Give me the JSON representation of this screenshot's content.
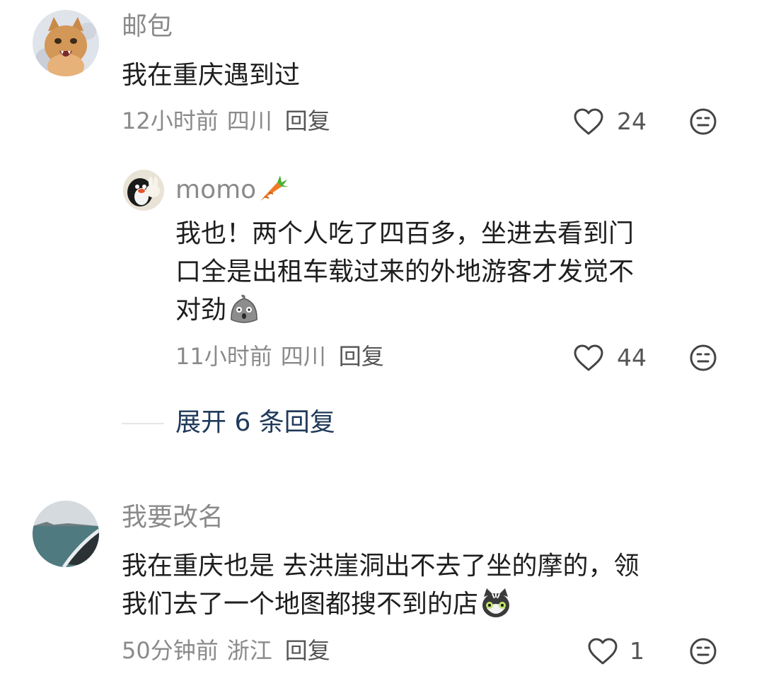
{
  "comments": [
    {
      "username": "邮包",
      "content": "我在重庆遇到过",
      "time": "12小时前",
      "location": "四川",
      "reply_label": "回复",
      "likes": "24"
    },
    {
      "username": "momo",
      "content": "我也！两个人吃了四百多，坐进去看到门\n口全是出租车载过来的外地游客才发觉不\n对劲",
      "time": "11小时前",
      "location": "四川",
      "reply_label": "回复",
      "likes": "44"
    },
    {
      "username": "我要改名",
      "content": "我在重庆也是 去洪崖洞出不去了坐的摩的，领\n我们去了一个地图都搜不到的店",
      "time": "50分钟前",
      "location": "浙江",
      "reply_label": "回复",
      "likes": "1"
    }
  ],
  "expand_replies": "展开 6 条回复",
  "icons": {
    "like": "heart-outline-icon",
    "dislike": "neutral-face-icon",
    "carrot": "carrot-emoji",
    "shocked": "shocked-blob-emoji",
    "cat": "sweating-cat-emoji"
  },
  "colors": {
    "meta_text": "#8a8a8a",
    "expand_text": "#203a5a"
  }
}
